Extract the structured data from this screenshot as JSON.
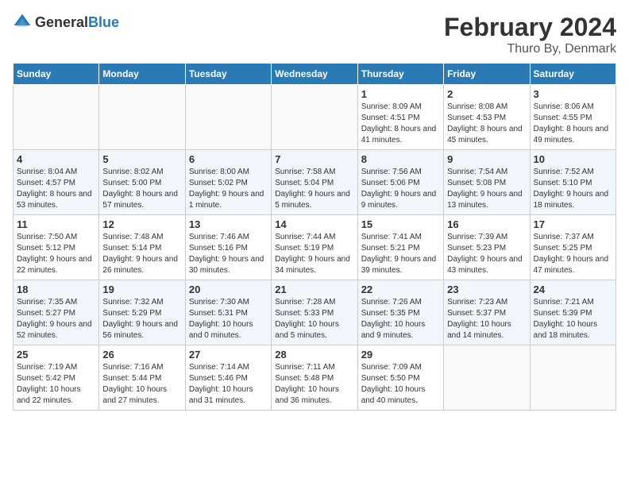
{
  "header": {
    "logo_general": "General",
    "logo_blue": "Blue",
    "title": "February 2024",
    "subtitle": "Thuro By, Denmark"
  },
  "weekdays": [
    "Sunday",
    "Monday",
    "Tuesday",
    "Wednesday",
    "Thursday",
    "Friday",
    "Saturday"
  ],
  "weeks": [
    [
      {
        "day": "",
        "sunrise": "",
        "sunset": "",
        "daylight": ""
      },
      {
        "day": "",
        "sunrise": "",
        "sunset": "",
        "daylight": ""
      },
      {
        "day": "",
        "sunrise": "",
        "sunset": "",
        "daylight": ""
      },
      {
        "day": "",
        "sunrise": "",
        "sunset": "",
        "daylight": ""
      },
      {
        "day": "1",
        "sunrise": "Sunrise: 8:09 AM",
        "sunset": "Sunset: 4:51 PM",
        "daylight": "Daylight: 8 hours and 41 minutes."
      },
      {
        "day": "2",
        "sunrise": "Sunrise: 8:08 AM",
        "sunset": "Sunset: 4:53 PM",
        "daylight": "Daylight: 8 hours and 45 minutes."
      },
      {
        "day": "3",
        "sunrise": "Sunrise: 8:06 AM",
        "sunset": "Sunset: 4:55 PM",
        "daylight": "Daylight: 8 hours and 49 minutes."
      }
    ],
    [
      {
        "day": "4",
        "sunrise": "Sunrise: 8:04 AM",
        "sunset": "Sunset: 4:57 PM",
        "daylight": "Daylight: 8 hours and 53 minutes."
      },
      {
        "day": "5",
        "sunrise": "Sunrise: 8:02 AM",
        "sunset": "Sunset: 5:00 PM",
        "daylight": "Daylight: 8 hours and 57 minutes."
      },
      {
        "day": "6",
        "sunrise": "Sunrise: 8:00 AM",
        "sunset": "Sunset: 5:02 PM",
        "daylight": "Daylight: 9 hours and 1 minute."
      },
      {
        "day": "7",
        "sunrise": "Sunrise: 7:58 AM",
        "sunset": "Sunset: 5:04 PM",
        "daylight": "Daylight: 9 hours and 5 minutes."
      },
      {
        "day": "8",
        "sunrise": "Sunrise: 7:56 AM",
        "sunset": "Sunset: 5:06 PM",
        "daylight": "Daylight: 9 hours and 9 minutes."
      },
      {
        "day": "9",
        "sunrise": "Sunrise: 7:54 AM",
        "sunset": "Sunset: 5:08 PM",
        "daylight": "Daylight: 9 hours and 13 minutes."
      },
      {
        "day": "10",
        "sunrise": "Sunrise: 7:52 AM",
        "sunset": "Sunset: 5:10 PM",
        "daylight": "Daylight: 9 hours and 18 minutes."
      }
    ],
    [
      {
        "day": "11",
        "sunrise": "Sunrise: 7:50 AM",
        "sunset": "Sunset: 5:12 PM",
        "daylight": "Daylight: 9 hours and 22 minutes."
      },
      {
        "day": "12",
        "sunrise": "Sunrise: 7:48 AM",
        "sunset": "Sunset: 5:14 PM",
        "daylight": "Daylight: 9 hours and 26 minutes."
      },
      {
        "day": "13",
        "sunrise": "Sunrise: 7:46 AM",
        "sunset": "Sunset: 5:16 PM",
        "daylight": "Daylight: 9 hours and 30 minutes."
      },
      {
        "day": "14",
        "sunrise": "Sunrise: 7:44 AM",
        "sunset": "Sunset: 5:19 PM",
        "daylight": "Daylight: 9 hours and 34 minutes."
      },
      {
        "day": "15",
        "sunrise": "Sunrise: 7:41 AM",
        "sunset": "Sunset: 5:21 PM",
        "daylight": "Daylight: 9 hours and 39 minutes."
      },
      {
        "day": "16",
        "sunrise": "Sunrise: 7:39 AM",
        "sunset": "Sunset: 5:23 PM",
        "daylight": "Daylight: 9 hours and 43 minutes."
      },
      {
        "day": "17",
        "sunrise": "Sunrise: 7:37 AM",
        "sunset": "Sunset: 5:25 PM",
        "daylight": "Daylight: 9 hours and 47 minutes."
      }
    ],
    [
      {
        "day": "18",
        "sunrise": "Sunrise: 7:35 AM",
        "sunset": "Sunset: 5:27 PM",
        "daylight": "Daylight: 9 hours and 52 minutes."
      },
      {
        "day": "19",
        "sunrise": "Sunrise: 7:32 AM",
        "sunset": "Sunset: 5:29 PM",
        "daylight": "Daylight: 9 hours and 56 minutes."
      },
      {
        "day": "20",
        "sunrise": "Sunrise: 7:30 AM",
        "sunset": "Sunset: 5:31 PM",
        "daylight": "Daylight: 10 hours and 0 minutes."
      },
      {
        "day": "21",
        "sunrise": "Sunrise: 7:28 AM",
        "sunset": "Sunset: 5:33 PM",
        "daylight": "Daylight: 10 hours and 5 minutes."
      },
      {
        "day": "22",
        "sunrise": "Sunrise: 7:26 AM",
        "sunset": "Sunset: 5:35 PM",
        "daylight": "Daylight: 10 hours and 9 minutes."
      },
      {
        "day": "23",
        "sunrise": "Sunrise: 7:23 AM",
        "sunset": "Sunset: 5:37 PM",
        "daylight": "Daylight: 10 hours and 14 minutes."
      },
      {
        "day": "24",
        "sunrise": "Sunrise: 7:21 AM",
        "sunset": "Sunset: 5:39 PM",
        "daylight": "Daylight: 10 hours and 18 minutes."
      }
    ],
    [
      {
        "day": "25",
        "sunrise": "Sunrise: 7:19 AM",
        "sunset": "Sunset: 5:42 PM",
        "daylight": "Daylight: 10 hours and 22 minutes."
      },
      {
        "day": "26",
        "sunrise": "Sunrise: 7:16 AM",
        "sunset": "Sunset: 5:44 PM",
        "daylight": "Daylight: 10 hours and 27 minutes."
      },
      {
        "day": "27",
        "sunrise": "Sunrise: 7:14 AM",
        "sunset": "Sunset: 5:46 PM",
        "daylight": "Daylight: 10 hours and 31 minutes."
      },
      {
        "day": "28",
        "sunrise": "Sunrise: 7:11 AM",
        "sunset": "Sunset: 5:48 PM",
        "daylight": "Daylight: 10 hours and 36 minutes."
      },
      {
        "day": "29",
        "sunrise": "Sunrise: 7:09 AM",
        "sunset": "Sunset: 5:50 PM",
        "daylight": "Daylight: 10 hours and 40 minutes."
      },
      {
        "day": "",
        "sunrise": "",
        "sunset": "",
        "daylight": ""
      },
      {
        "day": "",
        "sunrise": "",
        "sunset": "",
        "daylight": ""
      }
    ]
  ]
}
